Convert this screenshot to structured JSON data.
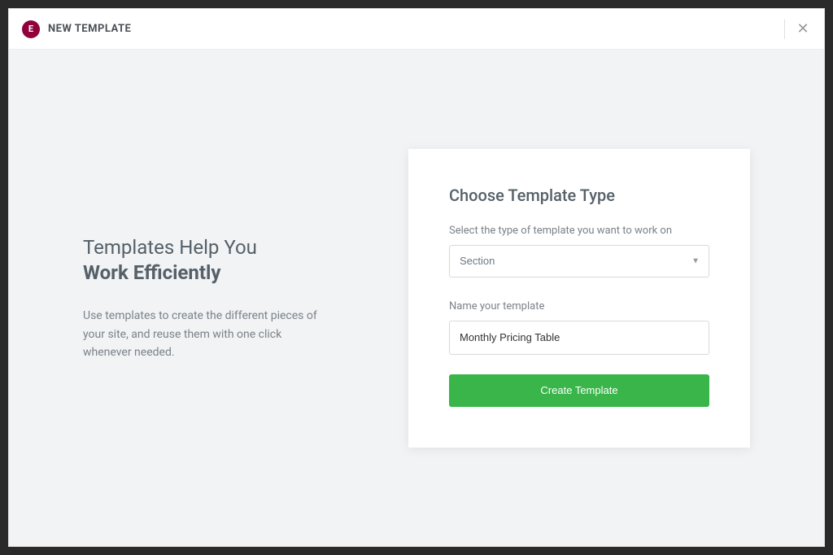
{
  "header": {
    "logo_text": "E",
    "title": "NEW TEMPLATE"
  },
  "left": {
    "heading_light": "Templates Help You",
    "heading_bold": "Work Efficiently",
    "description": "Use templates to create the different pieces of your site, and reuse them with one click whenever needed."
  },
  "form": {
    "title": "Choose Template Type",
    "type_label": "Select the type of template you want to work on",
    "type_value": "Section",
    "name_label": "Name your template",
    "name_value": "Monthly Pricing Table",
    "submit_label": "Create Template"
  }
}
